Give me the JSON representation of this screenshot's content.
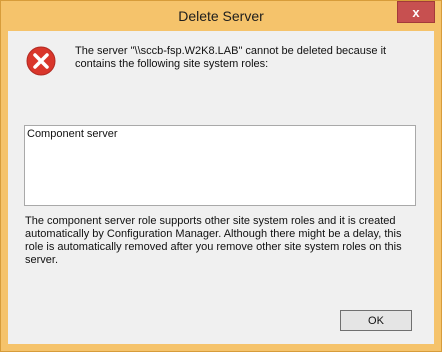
{
  "window": {
    "title": "Delete Server",
    "close_label": "x"
  },
  "dialog": {
    "icon": "error-icon",
    "message": "The server \"\\\\sccb-fsp.W2K8.LAB\" cannot be deleted because it contains the following site system roles:",
    "roles": [
      "Component server"
    ],
    "explanation": "The component server role supports other site system roles and it is created automatically by Configuration Manager. Although there might be a delay, this role is automatically removed after you remove other site system roles on this server.",
    "ok_label": "OK"
  },
  "colors": {
    "frame": "#f5c36b",
    "close": "#c75050",
    "client": "#f0f0f0",
    "error_icon": "#d9362b"
  }
}
